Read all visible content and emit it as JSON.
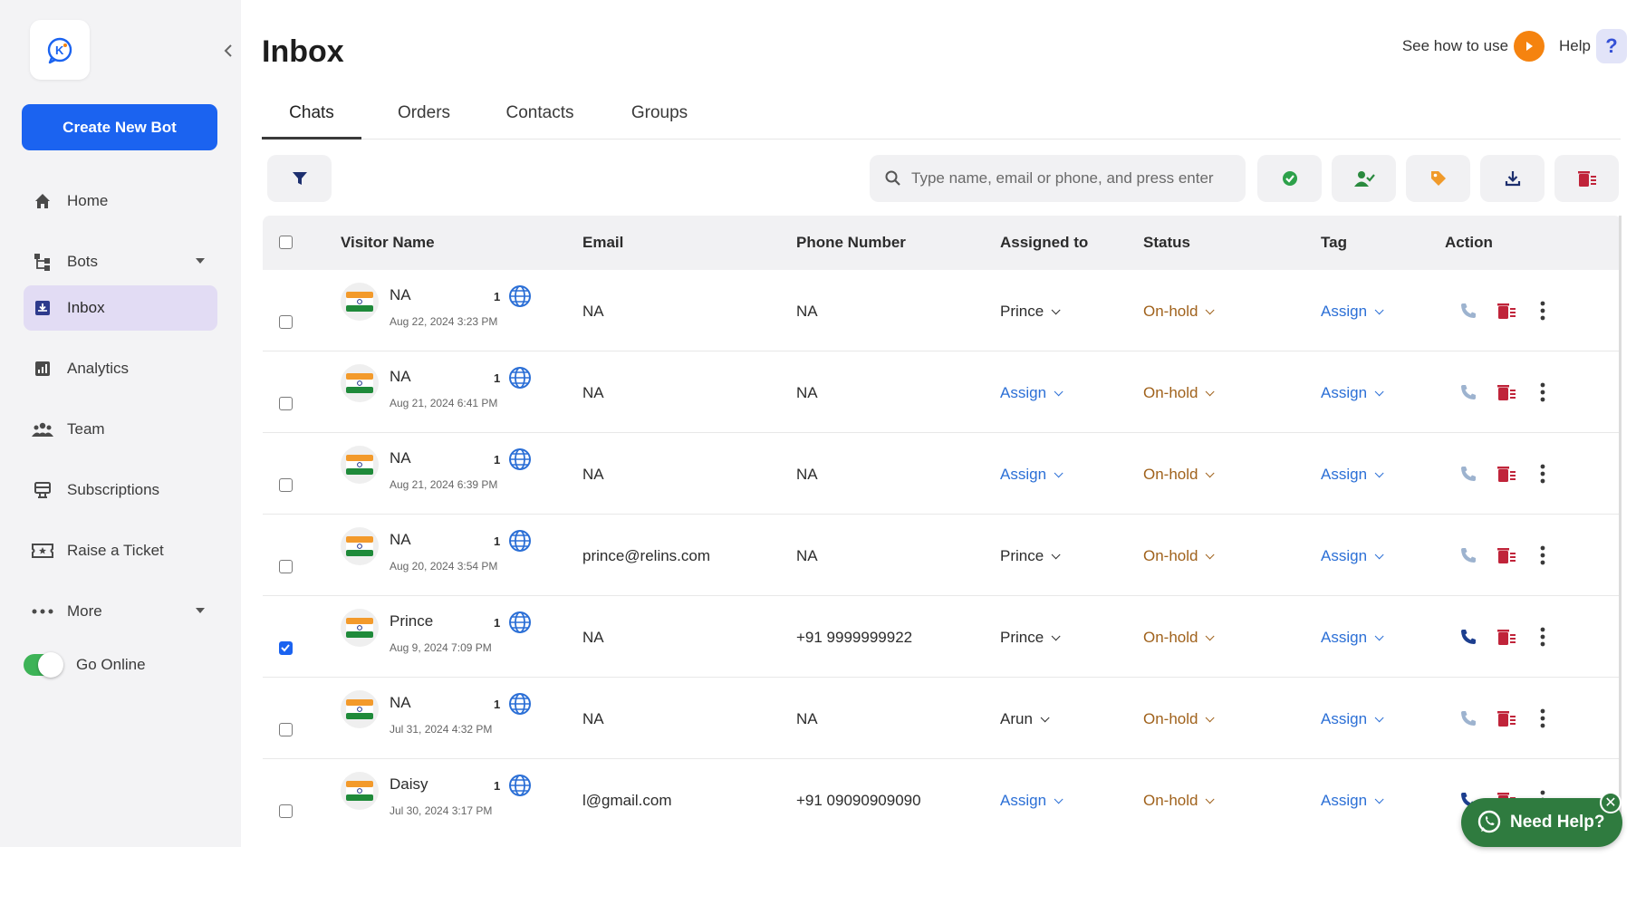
{
  "sidebar": {
    "create_label": "Create New Bot",
    "items": [
      {
        "label": "Home",
        "icon": "home-icon"
      },
      {
        "label": "Bots",
        "icon": "bots-icon"
      },
      {
        "label": "Inbox",
        "icon": "inbox-icon"
      },
      {
        "label": "Analytics",
        "icon": "analytics-icon"
      },
      {
        "label": "Team",
        "icon": "team-icon"
      },
      {
        "label": "Subscriptions",
        "icon": "subscriptions-icon"
      },
      {
        "label": "Raise a Ticket",
        "icon": "ticket-icon"
      },
      {
        "label": "More",
        "icon": "more-icon"
      }
    ],
    "active": "Inbox",
    "go_online_label": "Go Online",
    "go_online": true
  },
  "header": {
    "title": "Inbox",
    "see_how_label": "See how to use",
    "help_label": "Help",
    "help_symbol": "?"
  },
  "tabs": [
    {
      "label": "Chats",
      "active": true
    },
    {
      "label": "Orders",
      "active": false
    },
    {
      "label": "Contacts",
      "active": false
    },
    {
      "label": "Groups",
      "active": false
    }
  ],
  "search": {
    "placeholder": "Type name, email or phone, and press enter",
    "value": ""
  },
  "table": {
    "headers": [
      "Visitor Name",
      "Email",
      "Phone Number",
      "Assigned to",
      "Status",
      "Tag",
      "Action"
    ],
    "rows": [
      {
        "name": "NA",
        "date": "Aug 22, 2024 3:23 PM",
        "count": "1",
        "email": "NA",
        "phone": "NA",
        "assigned": "Prince",
        "status": "On-hold",
        "tag": "Assign",
        "checked": false
      },
      {
        "name": "NA",
        "date": "Aug 21, 2024 6:41 PM",
        "count": "1",
        "email": "NA",
        "phone": "NA",
        "assigned": "Assign",
        "status": "On-hold",
        "tag": "Assign",
        "checked": false
      },
      {
        "name": "NA",
        "date": "Aug 21, 2024 6:39 PM",
        "count": "1",
        "email": "NA",
        "phone": "NA",
        "assigned": "Assign",
        "status": "On-hold",
        "tag": "Assign",
        "checked": false
      },
      {
        "name": "NA",
        "date": "Aug 20, 2024 3:54 PM",
        "count": "1",
        "email": "prince@relins.com",
        "phone": "NA",
        "assigned": "Prince",
        "status": "On-hold",
        "tag": "Assign",
        "checked": false
      },
      {
        "name": "Prince",
        "date": "Aug 9, 2024 7:09 PM",
        "count": "1",
        "email": "NA",
        "phone": "+91 9999999922",
        "assigned": "Prince",
        "status": "On-hold",
        "tag": "Assign",
        "checked": true
      },
      {
        "name": "NA",
        "date": "Jul 31, 2024 4:32 PM",
        "count": "1",
        "email": "NA",
        "phone": "NA",
        "assigned": "Arun",
        "status": "On-hold",
        "tag": "Assign",
        "checked": false
      },
      {
        "name": "Daisy",
        "date": "Jul 30, 2024 3:17 PM",
        "count": "1",
        "email": "l@gmail.com",
        "phone": "+91 09090909090",
        "assigned": "Assign",
        "status": "On-hold",
        "tag": "Assign",
        "checked": false
      }
    ]
  },
  "need_help": {
    "label": "Need Help?",
    "close": "✕"
  },
  "colors": {
    "primary": "#1b63f0",
    "active_nav": "#e2dcf4",
    "status": "#a0621c",
    "link": "#2b6fd6",
    "delete": "#c0243a",
    "online": "#3db357",
    "whatsapp": "#2f7b3f"
  }
}
